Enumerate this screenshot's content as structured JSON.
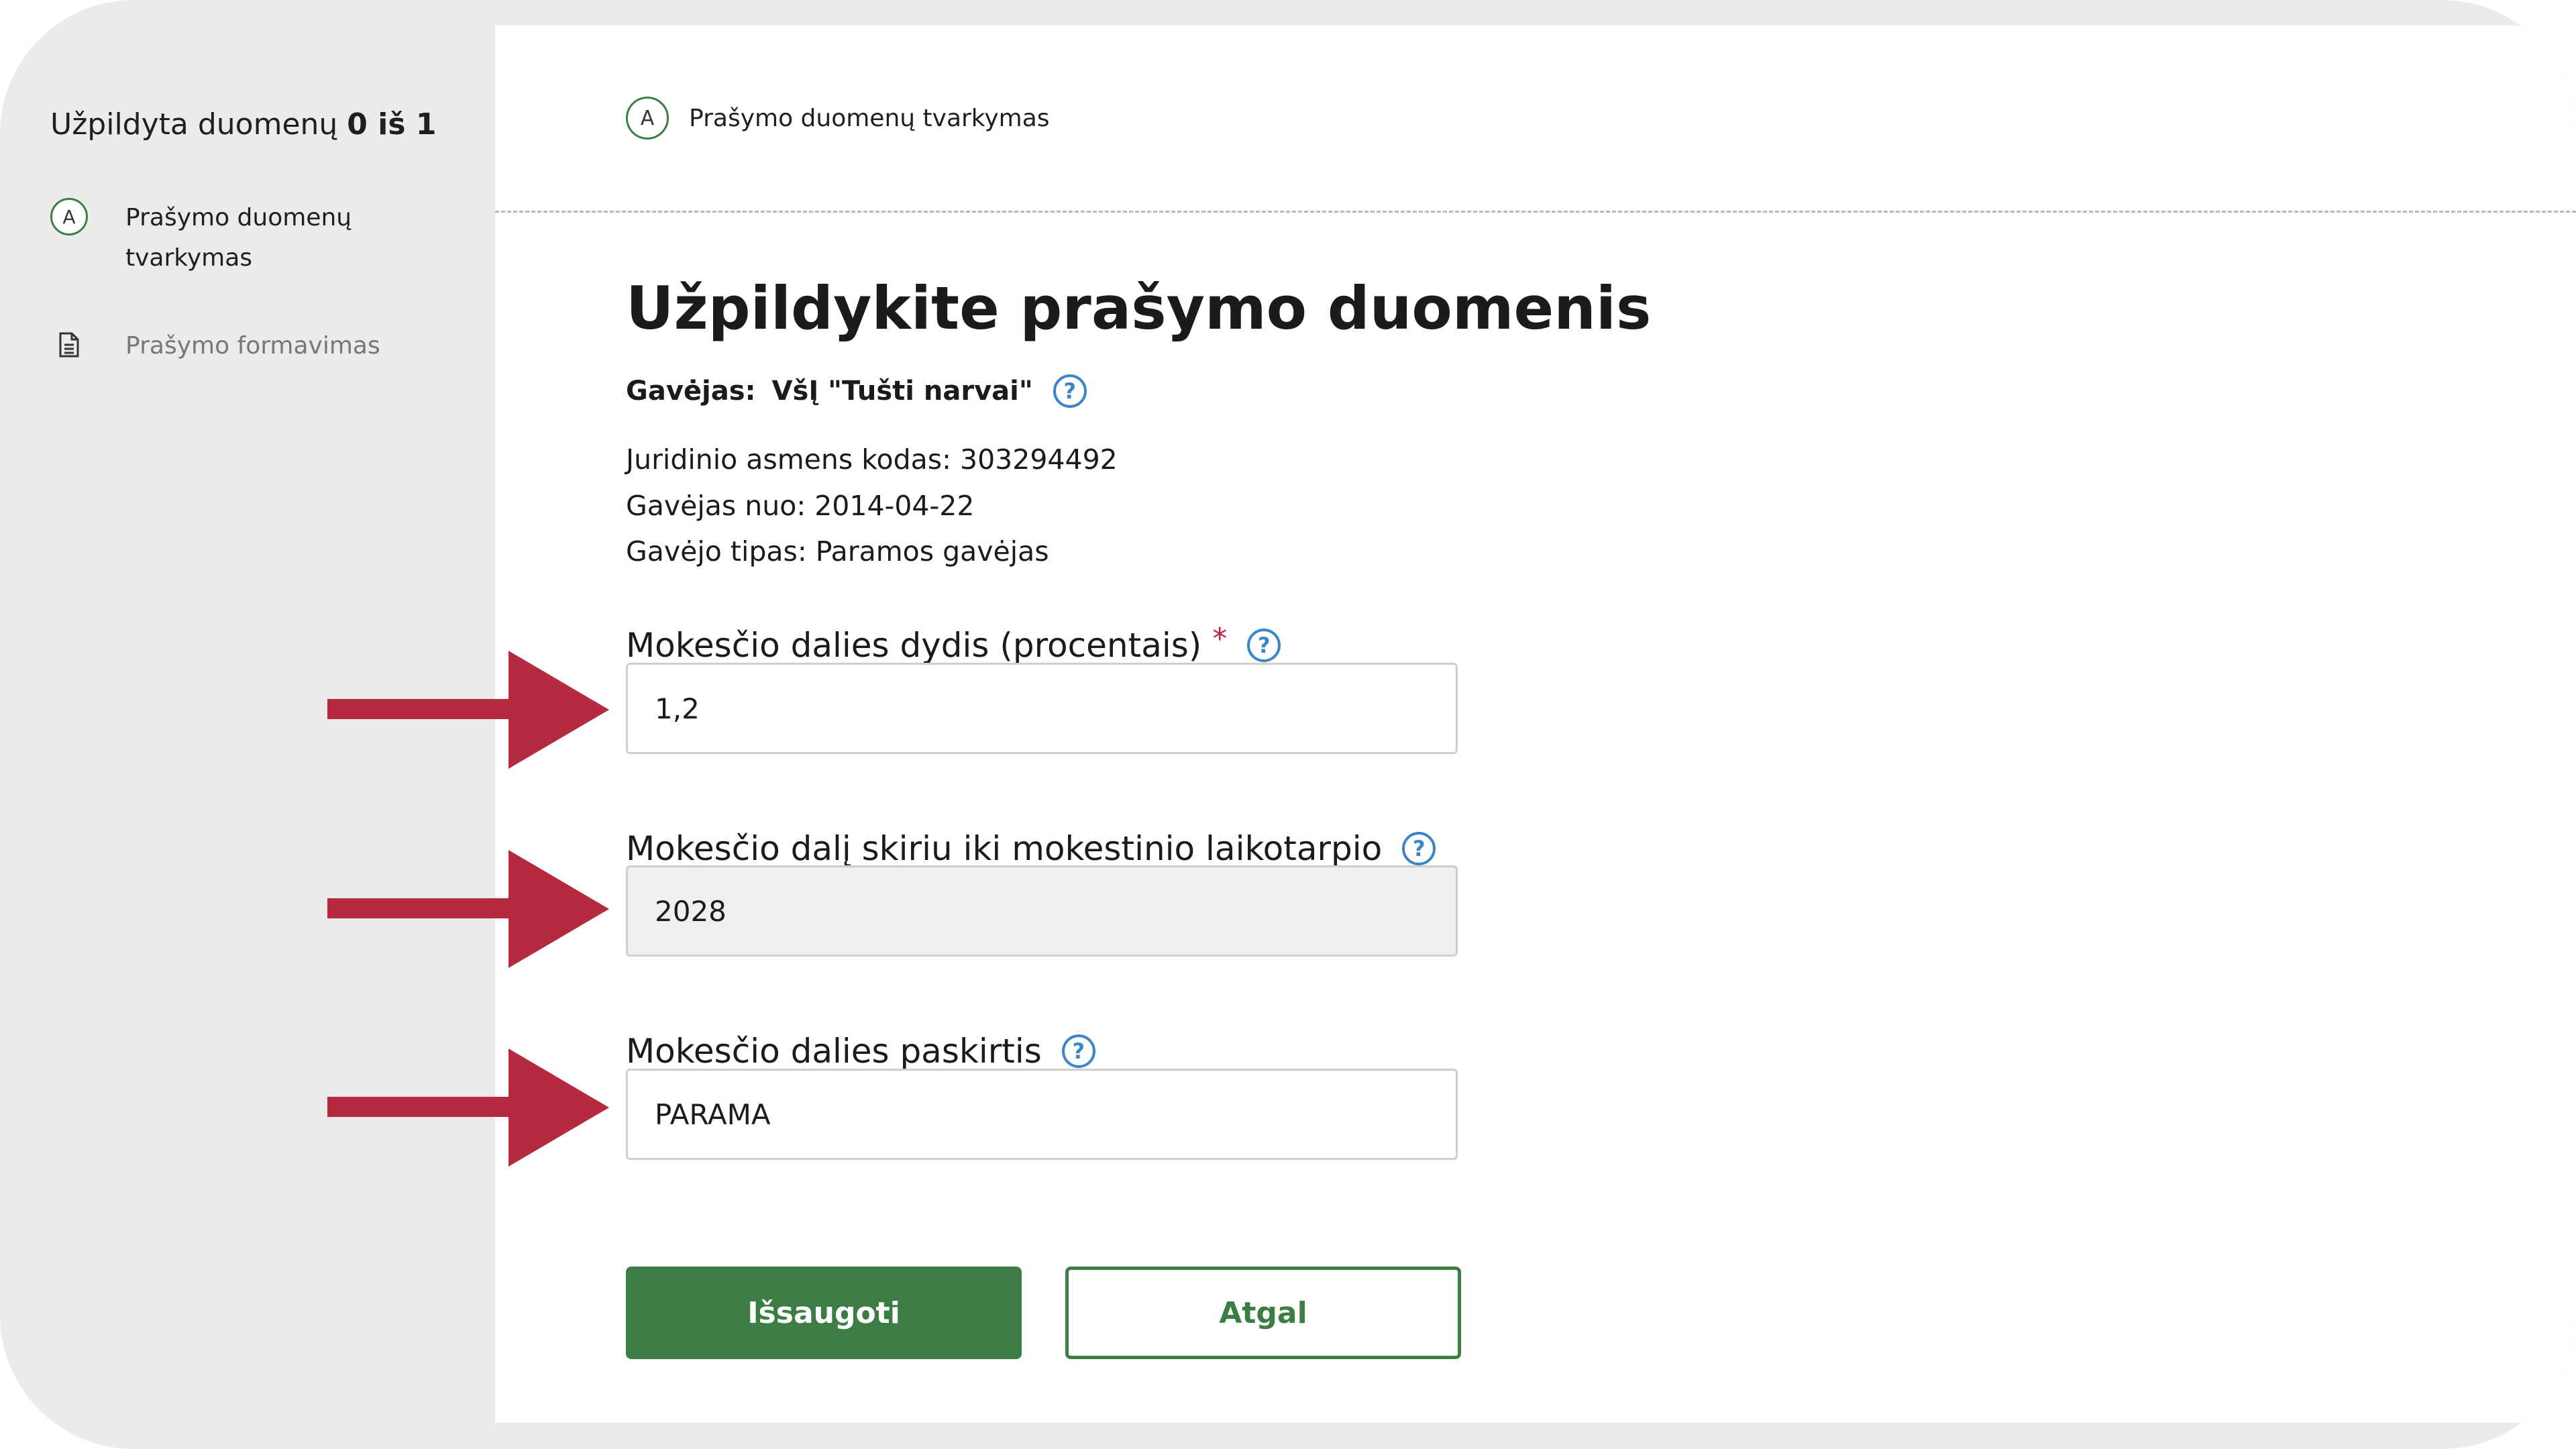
{
  "sidebar": {
    "progress_prefix": "Užpildyta duomenų",
    "progress_count": "0 iš 1",
    "steps": [
      {
        "badge": "A",
        "label": "Prašymo duomenų tvarkymas"
      },
      {
        "badge": "",
        "label": "Prašymo formavimas"
      }
    ]
  },
  "breadcrumb": {
    "badge": "A",
    "label": "Prašymo duomenų tvarkymas"
  },
  "main": {
    "title": "Užpildykite prašymo duomenis",
    "recipient_label": "Gavėjas:",
    "recipient_name": "VšĮ \"Tušti narvai\"",
    "info": [
      "Juridinio asmens kodas: 303294492",
      "Gavėjas nuo: 2014-04-22",
      "Gavėjo tipas: Paramos gavėjas"
    ],
    "fields": [
      {
        "label": "Mokesčio dalies dydis (procentais)",
        "required_mark": "*",
        "value": "1,2"
      },
      {
        "label": "Mokesčio dalį skiriu iki mokestinio laikotarpio",
        "value": "2028"
      },
      {
        "label": "Mokesčio dalies paskirtis",
        "value": "PARAMA"
      }
    ],
    "buttons": {
      "save": "Išsaugoti",
      "back": "Atgal"
    }
  },
  "icons": {
    "help": "question-circle-icon",
    "document": "document-icon",
    "arrow": "arrow-right-icon"
  },
  "colors": {
    "primary_green": "#3b7d44",
    "help_blue": "#3a86c8",
    "arrow_red": "#b62a40",
    "required_red": "#c0263b"
  }
}
